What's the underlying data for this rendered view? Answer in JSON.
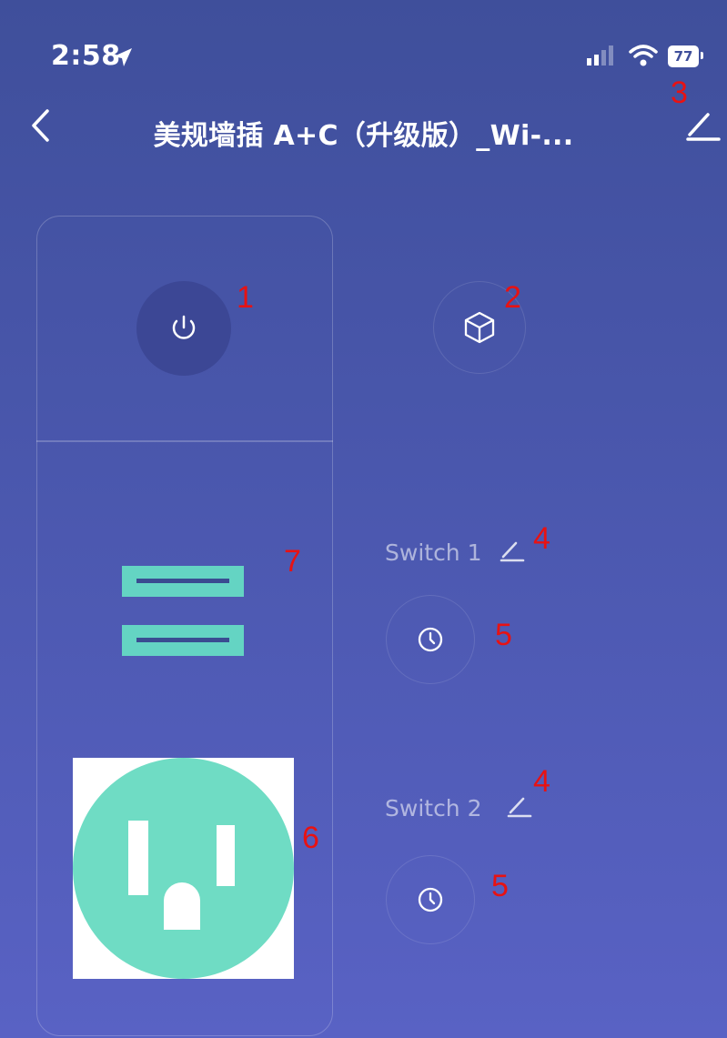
{
  "status_bar": {
    "time": "2:58",
    "battery": "77"
  },
  "header": {
    "title": "美规墙插 A+C（升级版）_Wi-..."
  },
  "switches": [
    {
      "label": "Switch 1"
    },
    {
      "label": "Switch 2"
    }
  ],
  "annotations": [
    "1",
    "2",
    "3",
    "4",
    "5",
    "7",
    "6",
    "4",
    "5"
  ],
  "colors": {
    "background_top": "#3f4f9b",
    "background_bottom": "#5962c4",
    "accent_teal": "#64d4c3",
    "annotation_red": "#e81212"
  },
  "icons": {
    "power": "power-icon",
    "scene": "cube-icon",
    "timer": "clock-icon",
    "edit": "pencil-icon",
    "back": "chevron-left-icon",
    "location": "location-arrow-icon"
  }
}
